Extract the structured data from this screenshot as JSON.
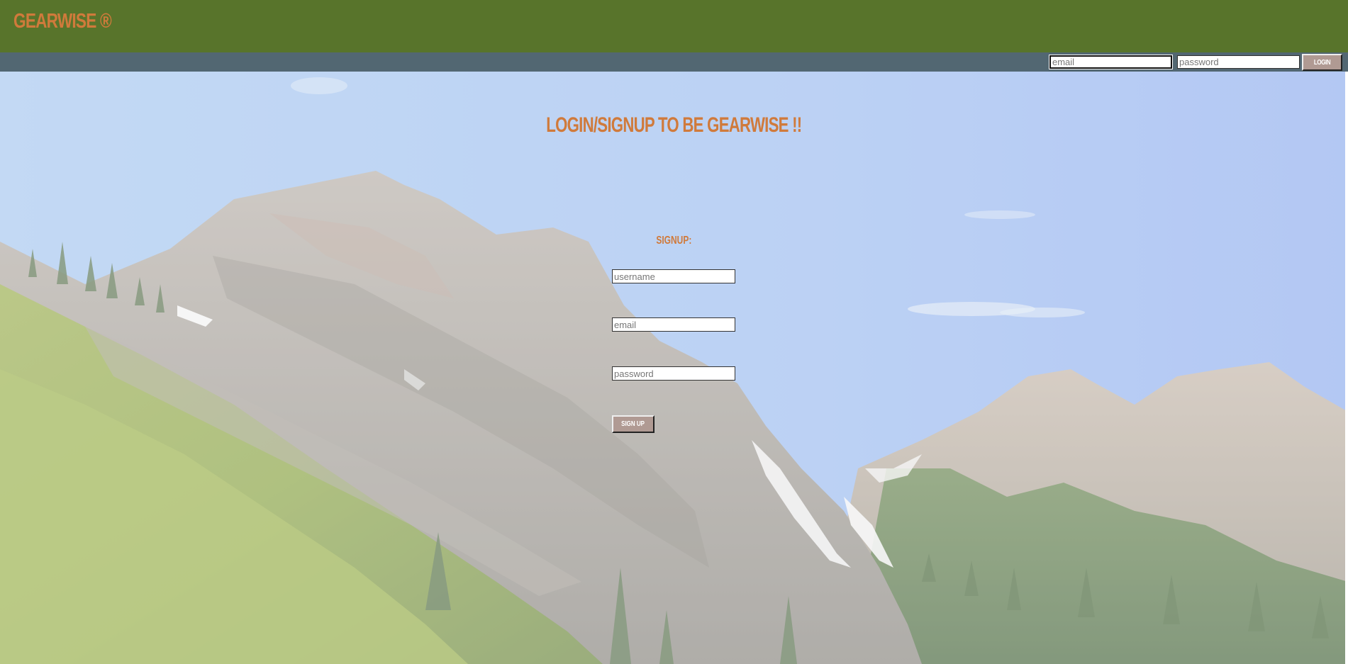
{
  "header": {
    "brand": "GEARWISE ®"
  },
  "login": {
    "email_placeholder": "email",
    "password_placeholder": "password",
    "button_label": "LOGIN"
  },
  "main": {
    "title": "LOGIN/SIGNUP TO BE GEARWISE !!",
    "signup_label": "SIGNUP:",
    "signup_form": {
      "username_placeholder": "username",
      "email_placeholder": "email",
      "password_placeholder": "password",
      "button_label": "SIGN UP"
    },
    "background": "mountain-landscape-photo"
  },
  "colors": {
    "header_bg": "#58742b",
    "login_bar_bg": "#526772",
    "accent_text": "#d07a3b",
    "button_bg": "#b09a93",
    "button_text": "#ffffff"
  }
}
